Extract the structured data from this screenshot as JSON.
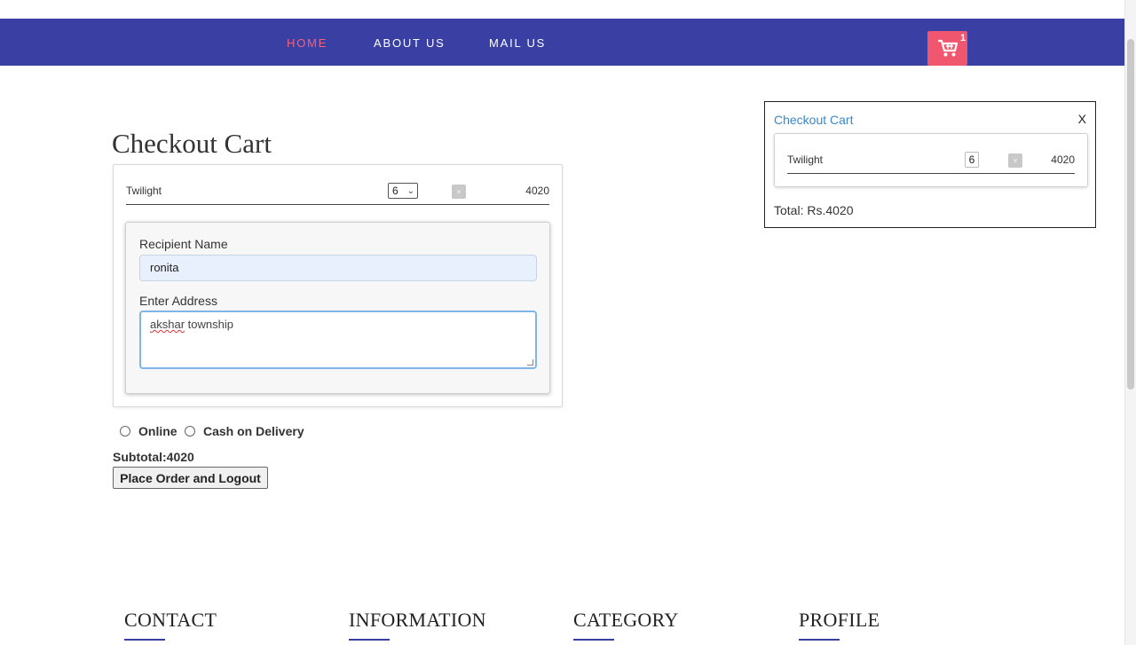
{
  "nav": {
    "links": [
      "HOME",
      "ABOUT US",
      "MAIL US"
    ],
    "active": "HOME",
    "cart_count": "1"
  },
  "colors": {
    "navbar": "#3a40a3",
    "active_link": "#f2627b",
    "cart_button": "#f0566d",
    "mini_cart_title": "#3a87c8"
  },
  "icons": {
    "cart": "shopping-cart-icon",
    "remove": "close-icon",
    "select": "chevron-down-icon"
  },
  "main": {
    "title": "Checkout Cart",
    "item": {
      "name": "Twilight",
      "quantity": "6",
      "remove_label": "×",
      "price": "4020"
    },
    "form": {
      "recipient_label": "Recipient Name",
      "recipient_value": "ronita",
      "address_label": "Enter Address",
      "address_value_word1": "akshar",
      "address_value_rest": " township"
    },
    "payment_options": [
      "Online",
      "Cash on Delivery"
    ],
    "subtotal": "Subtotal:4020",
    "place_order_label": "Place Order and Logout"
  },
  "mini_cart": {
    "title": "Checkout Cart",
    "close_label": "X",
    "item": {
      "name": "Twilight",
      "quantity": "6",
      "remove_label": "×",
      "price": "4020"
    },
    "total": "Total: Rs.4020"
  },
  "footer": {
    "headings": [
      "CONTACT",
      "INFORMATION",
      "CATEGORY",
      "PROFILE"
    ]
  }
}
